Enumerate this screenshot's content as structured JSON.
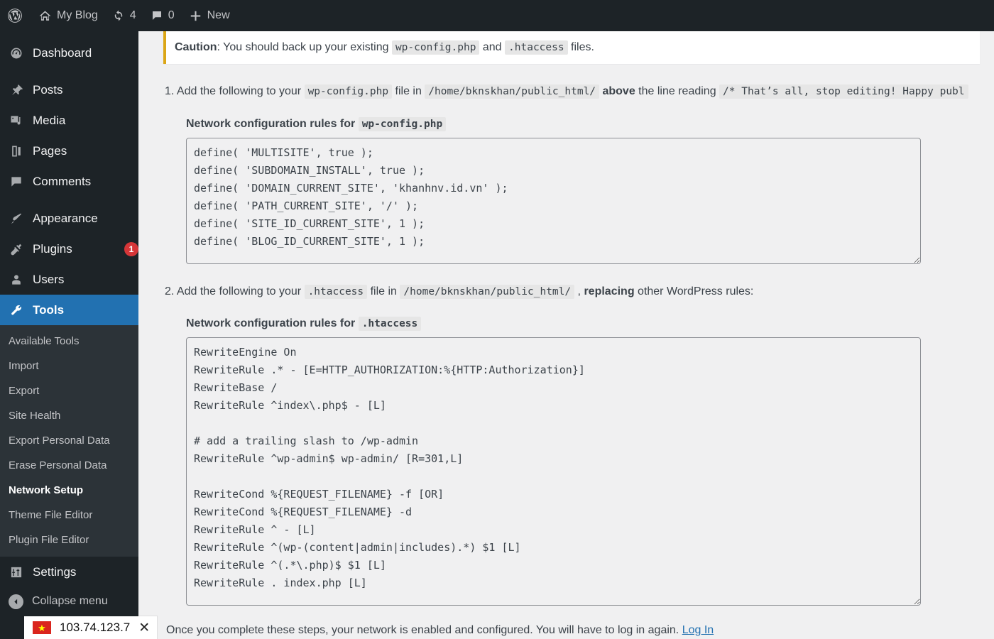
{
  "adminbar": {
    "logo_icon": "wordpress-logo-icon",
    "site_name": "My Blog",
    "home_icon": "home-icon",
    "updates_icon": "updates-icon",
    "updates_count": "4",
    "comments_icon": "comment-bubble-icon",
    "comments_count": "0",
    "new_icon": "plus-icon",
    "new_label": "New"
  },
  "sidebar": {
    "items": [
      {
        "label": "Dashboard",
        "icon": "dashboard-icon",
        "name": "dashboard"
      },
      {
        "label": "Posts",
        "icon": "pin-icon",
        "name": "posts"
      },
      {
        "label": "Media",
        "icon": "media-icon",
        "name": "media"
      },
      {
        "label": "Pages",
        "icon": "pages-icon",
        "name": "pages"
      },
      {
        "label": "Comments",
        "icon": "comment-bubble-icon",
        "name": "comments"
      },
      {
        "label": "Appearance",
        "icon": "paintbrush-icon",
        "name": "appearance"
      },
      {
        "label": "Plugins",
        "icon": "plug-icon",
        "name": "plugins",
        "badge": "1"
      },
      {
        "label": "Users",
        "icon": "user-icon",
        "name": "users"
      },
      {
        "label": "Tools",
        "icon": "wrench-icon",
        "name": "tools",
        "current": true
      },
      {
        "label": "Settings",
        "icon": "sliders-icon",
        "name": "settings"
      }
    ],
    "submenu": [
      {
        "label": "Available Tools",
        "name": "available-tools"
      },
      {
        "label": "Import",
        "name": "import"
      },
      {
        "label": "Export",
        "name": "export"
      },
      {
        "label": "Site Health",
        "name": "site-health"
      },
      {
        "label": "Export Personal Data",
        "name": "export-personal-data"
      },
      {
        "label": "Erase Personal Data",
        "name": "erase-personal-data"
      },
      {
        "label": "Network Setup",
        "name": "network-setup",
        "current": true
      },
      {
        "label": "Theme File Editor",
        "name": "theme-file-editor"
      },
      {
        "label": "Plugin File Editor",
        "name": "plugin-file-editor"
      }
    ],
    "collapse_label": "Collapse menu",
    "collapse_icon": "collapse-arrow-icon"
  },
  "content": {
    "caution": {
      "strong": "Caution",
      "text_1": ": You should back up your existing ",
      "code_1": "wp-config.php",
      "text_2": " and ",
      "code_2": ".htaccess",
      "text_3": " files."
    },
    "step1": {
      "number": "1.",
      "text_1": " Add the following to your ",
      "code_file": "wp-config.php",
      "text_2": " file in ",
      "code_path": "/home/bknskhan/public_html/",
      "strong": "above",
      "text_3": " the line reading ",
      "code_line": "/* That’s all, stop editing! Happy publ"
    },
    "block1": {
      "label_text": "Network configuration rules for ",
      "label_code": "wp-config.php",
      "value": "define( 'MULTISITE', true );\ndefine( 'SUBDOMAIN_INSTALL', true );\ndefine( 'DOMAIN_CURRENT_SITE', 'khanhnv.id.vn' );\ndefine( 'PATH_CURRENT_SITE', '/' );\ndefine( 'SITE_ID_CURRENT_SITE', 1 );\ndefine( 'BLOG_ID_CURRENT_SITE', 1 );"
    },
    "step2": {
      "number": "2.",
      "text_1": " Add the following to your ",
      "code_file": ".htaccess",
      "text_2": " file in ",
      "code_path": "/home/bknskhan/public_html/",
      "text_3": " , ",
      "strong": "replacing",
      "text_4": " other WordPress rules:"
    },
    "block2": {
      "label_text": "Network configuration rules for ",
      "label_code": ".htaccess",
      "value": "RewriteEngine On\nRewriteRule .* - [E=HTTP_AUTHORIZATION:%{HTTP:Authorization}]\nRewriteBase /\nRewriteRule ^index\\.php$ - [L]\n\n# add a trailing slash to /wp-admin\nRewriteRule ^wp-admin$ wp-admin/ [R=301,L]\n\nRewriteCond %{REQUEST_FILENAME} -f [OR]\nRewriteCond %{REQUEST_FILENAME} -d\nRewriteRule ^ - [L]\nRewriteRule ^(wp-(content|admin|includes).*) $1 [L]\nRewriteRule ^(.*\\.php)$ $1 [L]\nRewriteRule . index.php [L]"
    },
    "footer": {
      "text": "Once you complete these steps, your network is enabled and configured. You will have to log in again. ",
      "link": "Log In"
    }
  },
  "ip_badge": {
    "flag_icon": "vietnam-flag-icon",
    "ip": "103.74.123.7",
    "close_icon": "close-icon"
  },
  "colors": {
    "sidebar_bg": "#1d2327",
    "submenu_bg": "#2c3338",
    "accent_blue": "#2271b1",
    "caution_border": "#dba617",
    "badge_red": "#d63638",
    "page_bg": "#f0f0f1"
  }
}
